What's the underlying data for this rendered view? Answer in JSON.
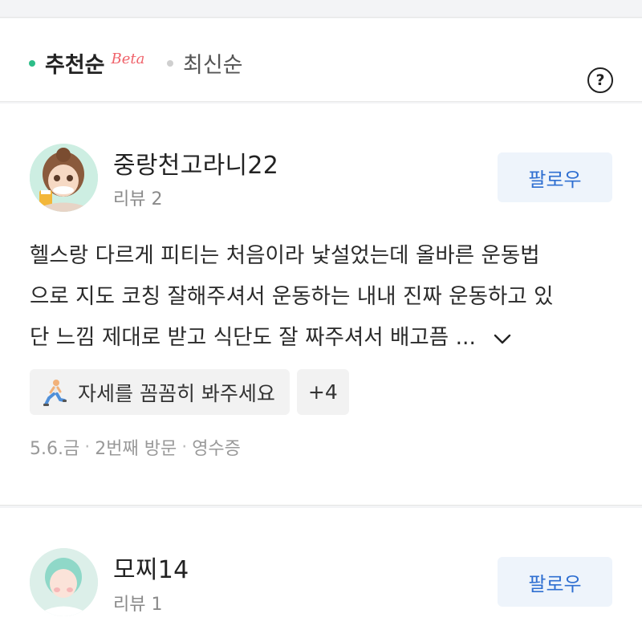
{
  "sort": {
    "recommended": "추천순",
    "beta": "Beta",
    "latest": "최신순",
    "help": "?"
  },
  "reviews": [
    {
      "nickname": "중랑천고라니22",
      "review_count": "리뷰 2",
      "follow": "팔로우",
      "text_line1": "헬스랑 다르게 피티는 처음이라 낯설었는데 올바른 운동법",
      "text_line2": "으로 지도 코칭 잘해주셔서 운동하는 내내 진짜 운동하고 있",
      "text_line3": "단 느낌 제대로 받고 식단도 잘 짜주셔서 배고픔 ...",
      "tag": "자세를 꼼꼼히 봐주세요",
      "tag_more": "+4",
      "date": "5.6.금",
      "visit": "2번째 방문",
      "receipt": "영수증",
      "meta_sep": "·"
    },
    {
      "nickname": "모찌14",
      "review_count": "리뷰 1",
      "follow": "팔로우"
    }
  ],
  "colors": {
    "accent_green": "#2dbd88",
    "beta_red": "#f0636b",
    "follow_text": "#2f6fd1",
    "follow_bg": "#eef4fb"
  },
  "icons": {
    "help": "question-circle-icon",
    "expand": "chevron-down-icon",
    "tag": "exercise-lunge-emoji"
  }
}
